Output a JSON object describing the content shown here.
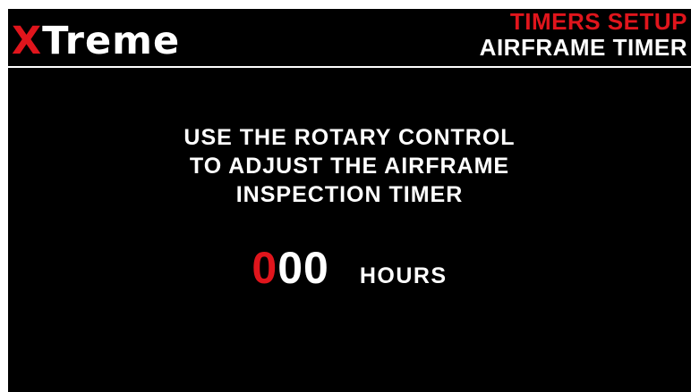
{
  "header": {
    "logo_first": "X",
    "logo_rest": "Treme",
    "menu_title": "TIMERS SETUP",
    "page_title": "AIRFRAME TIMER"
  },
  "main": {
    "instruction_lines": [
      "USE THE ROTARY CONTROL",
      "TO ADJUST THE AIRFRAME",
      "INSPECTION TIMER"
    ],
    "timer": {
      "active_digit": "0",
      "other_digits": "00",
      "unit": "HOURS"
    }
  },
  "colors": {
    "accent": "#e0151c",
    "text": "#ffffff",
    "background": "#000000"
  }
}
